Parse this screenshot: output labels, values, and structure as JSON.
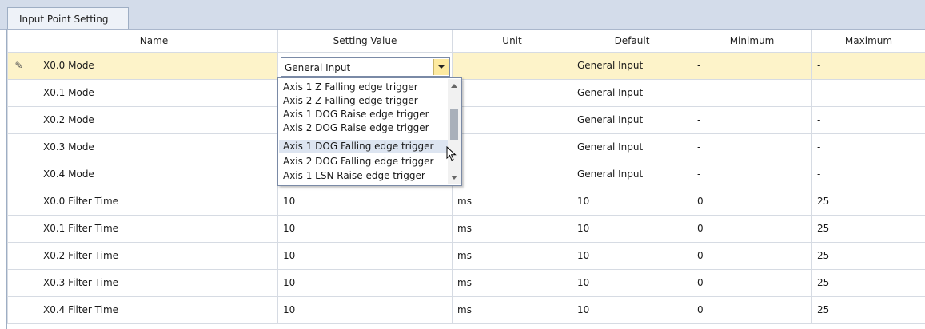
{
  "tab": {
    "label": "Input Point Setting"
  },
  "columns": [
    "Name",
    "Setting Value",
    "Unit",
    "Default",
    "Minimum",
    "Maximum"
  ],
  "rows": [
    {
      "name": "X0.0 Mode",
      "value": "General Input",
      "unit": "",
      "default": "General Input",
      "min": "-",
      "max": "-"
    },
    {
      "name": "X0.1 Mode",
      "value": "",
      "unit": "",
      "default": "General Input",
      "min": "-",
      "max": "-"
    },
    {
      "name": "X0.2 Mode",
      "value": "",
      "unit": "",
      "default": "General Input",
      "min": "-",
      "max": "-"
    },
    {
      "name": "X0.3 Mode",
      "value": "",
      "unit": "",
      "default": "General Input",
      "min": "-",
      "max": "-"
    },
    {
      "name": "X0.4 Mode",
      "value": "",
      "unit": "",
      "default": "General Input",
      "min": "-",
      "max": "-"
    },
    {
      "name": "X0.0 Filter Time",
      "value": "10",
      "unit": "ms",
      "default": "10",
      "min": "0",
      "max": "25"
    },
    {
      "name": "X0.1 Filter Time",
      "value": "10",
      "unit": "ms",
      "default": "10",
      "min": "0",
      "max": "25"
    },
    {
      "name": "X0.2 Filter Time",
      "value": "10",
      "unit": "ms",
      "default": "10",
      "min": "0",
      "max": "25"
    },
    {
      "name": "X0.3 Filter Time",
      "value": "10",
      "unit": "ms",
      "default": "10",
      "min": "0",
      "max": "25"
    },
    {
      "name": "X0.4 Filter Time",
      "value": "10",
      "unit": "ms",
      "default": "10",
      "min": "0",
      "max": "25"
    }
  ],
  "editor": {
    "selected_value": "General Input"
  },
  "dropdown": {
    "items": [
      "Axis 1 Z Falling edge trigger",
      "Axis 2 Z Falling edge trigger",
      "Axis 1 DOG Raise edge trigger",
      "Axis 2 DOG Raise edge trigger",
      "Axis 1 DOG Falling edge trigger",
      "Axis 2 DOG Falling edge trigger",
      "Axis 1 LSN Raise edge trigger"
    ],
    "hovered_index": 4
  },
  "indicator": {
    "symbol": "✎"
  },
  "colors": {
    "selected_row": "#fdf3c9",
    "combo_button": "#fdeaa0",
    "hover_item": "#dde5f1",
    "header_bar": "#d3dcea"
  }
}
